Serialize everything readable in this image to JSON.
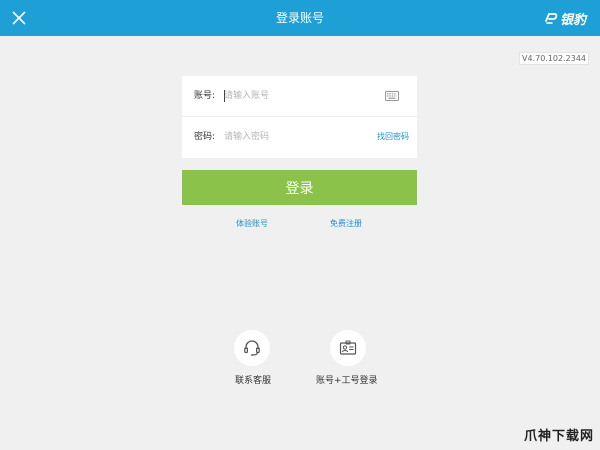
{
  "header": {
    "title": "登录账号",
    "logo_text": "银豹"
  },
  "version": "V4.70.102.2344",
  "form": {
    "account_label": "账号:",
    "account_placeholder": "请输入账号",
    "password_label": "密码:",
    "password_placeholder": "请输入密码",
    "forgot_password": "找回密码"
  },
  "login_button": "登录",
  "links": {
    "trial_account": "体验账号",
    "free_register": "免费注册"
  },
  "bottom": {
    "customer_service": "联系客服",
    "staff_login": "账号+工号登录"
  },
  "watermark": "爪神下载网",
  "colors": {
    "header": "#1e9fd6",
    "accent": "#8bc34a",
    "link": "#1e8fc9",
    "background": "#f0f0f0"
  },
  "icons": [
    "close-icon",
    "logo-icon",
    "keyboard-icon",
    "headset-icon",
    "id-card-icon"
  ]
}
